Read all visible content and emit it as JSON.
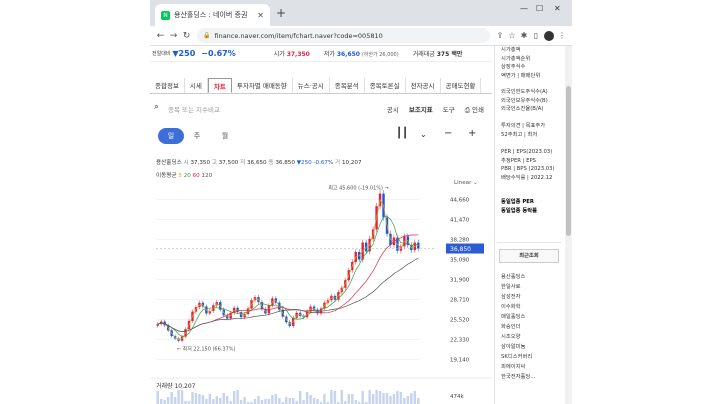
{
  "browser": {
    "tab_title": "용산홀딩스 : 네이버 증권",
    "url": "finance.naver.com/item/fchart.naver?code=005810"
  },
  "price_bar": {
    "prev_label": "전일대비",
    "diff": "▼250",
    "rate": "−0.67%",
    "open_label": "시가",
    "open": "37,350",
    "low_label": "저가",
    "low": "36,650",
    "lower_limit": "(하한가 26,000)",
    "amount_label": "거래대금",
    "amount": "375 백만"
  },
  "menu": [
    "종합정보",
    "시세",
    "차트",
    "투자자별 매매동향",
    "뉴스·공시",
    "종목분석",
    "종목토론실",
    "전자공시",
    "공매도현황"
  ],
  "active_menu": 2,
  "search": {
    "placeholder": "종목 또는 지수비교"
  },
  "tools": [
    "공시",
    "보조지표",
    "도구",
    "인쇄"
  ],
  "periods": [
    "일",
    "주",
    "월"
  ],
  "info": {
    "name": "용산홀딩스",
    "open_label": "시",
    "open": "37,350",
    "high_label": "고",
    "high": "37,500",
    "low_label": "저",
    "low": "36,650",
    "close_label": "종",
    "close": "36,850",
    "change": "▼250 -0.67%",
    "vol_label": "거",
    "volume": "10,207"
  },
  "ma": {
    "label": "이동평균",
    "p5": "5",
    "p20": "20",
    "p60": "60",
    "p120": "120"
  },
  "scale": "Linear",
  "volume_title": "거래량",
  "volume_value": "10,207",
  "volume_axis": "474k",
  "chart_data": {
    "type": "candlestick",
    "title": "",
    "y_ticks": [
      44660,
      41470,
      38280,
      35090,
      31900,
      28710,
      25520,
      22330,
      19140
    ],
    "ylim": [
      17800,
      46500
    ],
    "current": 36850,
    "high_annotation": "최고 45,600 (-19.01%)",
    "low_annotation": "최저 22,150 (66.37%)",
    "close_series": [
      24800,
      25200,
      24600,
      23800,
      22900,
      22500,
      22150,
      22800,
      24000,
      25300,
      26800,
      27500,
      28200,
      27600,
      26500,
      26900,
      27800,
      28300,
      27100,
      26200,
      25700,
      26600,
      27400,
      26700,
      25900,
      26400,
      27300,
      28600,
      29100,
      28300,
      27200,
      26500,
      27800,
      28900,
      28200,
      27100,
      26000,
      25100,
      24500,
      25800,
      26600,
      26100,
      25900,
      26800,
      27600,
      27100,
      26500,
      27300,
      28200,
      28600,
      29300,
      28700,
      29900,
      30600,
      31800,
      33400,
      34700,
      36300,
      35100,
      37800,
      36400,
      38400,
      39900,
      43600,
      45600,
      41800,
      39200,
      37400,
      38600,
      36500,
      37200,
      38800,
      37400,
      36600,
      37800,
      36850
    ],
    "ma_series": [
      {
        "name": "5",
        "color": "#e5a017"
      },
      {
        "name": "20",
        "color": "#2f9e44"
      },
      {
        "name": "60",
        "color": "#e12343"
      },
      {
        "name": "120",
        "color": "#555555"
      }
    ]
  },
  "right_pane": {
    "block1": [
      "시가총액",
      "시가총액순위",
      "상장주식수",
      "액면가 | 매매단위"
    ],
    "block2": [
      "외국인한도주식수(A)",
      "외국인보유주식수(B)",
      "외국인소진율(B/A)"
    ],
    "block3": [
      "투자의견 | 목표주가",
      "52주최고 | 최저"
    ],
    "block4": [
      "PER | EPS(2023.03)",
      "추정PER | EPS",
      "PBR | BPS (2023.03)",
      "배당수익률 | 2022.12"
    ],
    "block5": [
      "동일업종 PER",
      "동일업종 등락률"
    ],
    "recent_title": "최근조회",
    "recent": [
      "용산홀딩스",
      "한일사료",
      "삼성전자",
      "이수화학",
      "매일홀딩스",
      "화승인더",
      "시조오양",
      "삼아알미늄",
      "SK디스커버리",
      "피에이치씨",
      "한국전자홀딩..."
    ]
  }
}
